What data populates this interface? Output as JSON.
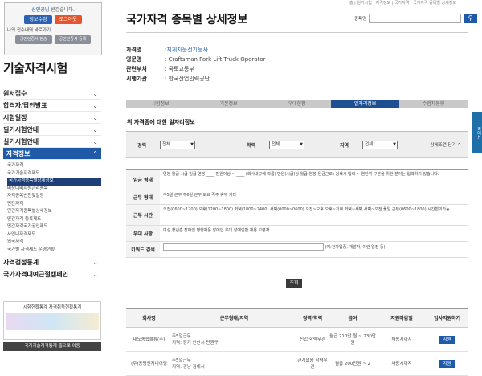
{
  "login": {
    "user": "산인공님",
    "greet": "반갑습니다.",
    "btn_info": "정보수정",
    "btn_logout": "로그아웃",
    "recent": "나의 접수내역 바로가기",
    "cert1": "공인인증서 전송",
    "cert2": "공인인증서 등록"
  },
  "sidebar": {
    "title": "기술자격시험",
    "items": [
      "원서접수",
      "합격자/답안발표",
      "시험일정",
      "필기시험안내",
      "실기시험안내"
    ],
    "active": "자격정보",
    "sub": [
      "국가자격",
      "국가기술자격제도",
      "국가자격종목별상세정보",
      "비상대비자원관리종목",
      "자격종목변천및일정",
      "민간자격",
      "민간자격종목별상세정보",
      "민간자격 등록제도",
      "민간자격국가공인제도",
      "사업내자격제도",
      "외국자격",
      "국가별 자격제도 운영현황"
    ],
    "bottom": [
      "자격검정통계",
      "국가자격대여근절캠페인"
    ]
  },
  "stats": {
    "title": "시험현황통계 자격취득현황통계",
    "btn": "국가기술자격통계 홈으로 이동"
  },
  "topnav": "홈 | 원기시험 | 자격정보 | 국가자격 | 국가자격 종목별 상세정보",
  "page": {
    "title": "국가자격 종목별 상세정보",
    "search_label": "종목명"
  },
  "info": [
    {
      "k": "자격명",
      "v": ":지게차운전기능사"
    },
    {
      "k": "영문명",
      "v": ": Craftsman Fork Lift Truck Operator"
    },
    {
      "k": "관련부처",
      "v": ": 국토교통부"
    },
    {
      "k": "시행기관",
      "v": ": 한국산업인력공단"
    }
  ],
  "tabs": [
    "시험정보",
    "기본정보",
    "우대현황",
    "일자리정보",
    "수험자동향"
  ],
  "section": "위 자격증에 대한 일자리정보",
  "filters": [
    {
      "label": "경력",
      "value": "전체"
    },
    {
      "label": "학력",
      "value": "전체"
    },
    {
      "label": "지역",
      "value": "전체"
    }
  ],
  "detail_toggle": "상세조건 닫기 ^",
  "conds": [
    {
      "k": "임금 형태",
      "v": "연봉 월급 시급 일급 연봉 ____ 만원이상 ~ ____ (회사내규에 따름) 만원(시급)상 월급 연봉(임금근로) 검색시 입력 ~ 연단위 구분을 위한 분야는 입력하지 않습니다."
    },
    {
      "k": "근무 형태",
      "v": "주5일 근무 주6일 근무 토요 격주 휴무 기타"
    },
    {
      "k": "근무 시간",
      "v": "오전(0600~1200) 오후(1200~1800) 저녁(1800~2400) 새벽(0000~0600) 오전~오후 오후~저녁 저녁~새벽 새벽~오전 풀일 근무(0600~1800) 시간협의가능"
    },
    {
      "k": "우대 사항",
      "v": "여성 청년층 장애인 병행채용 장애인 우대 장애인만 채용 고령자"
    },
    {
      "k": "키워드 검색",
      "v": "(예:전자업종, 개발자, 이런 일정 등)"
    }
  ],
  "search_btn": "조회",
  "table": {
    "headers": [
      "회사명",
      "근무형태/지역",
      "경력/학력",
      "급여",
      "지원마감일",
      "입사지원하기"
    ],
    "rows": [
      {
        "company": "대도종합물류(주)",
        "work": "주5일근무",
        "loc": "지역: 경기 안산시 단원구",
        "edu": "신입 학력무관",
        "pay": "월급 210만 원 ~ 230만원",
        "deadline": "채용시까지",
        "apply": "지원"
      },
      {
        "company": "(주)동명엔지니어링",
        "work": "주5일근무",
        "loc": "지역: 경남 김해시",
        "edu": "관계없음 학력무관",
        "pay": "월급 200만원 ~ 2",
        "deadline": "채용시까지",
        "apply": "지원"
      }
    ]
  },
  "side_widget": "퀵메뉴"
}
